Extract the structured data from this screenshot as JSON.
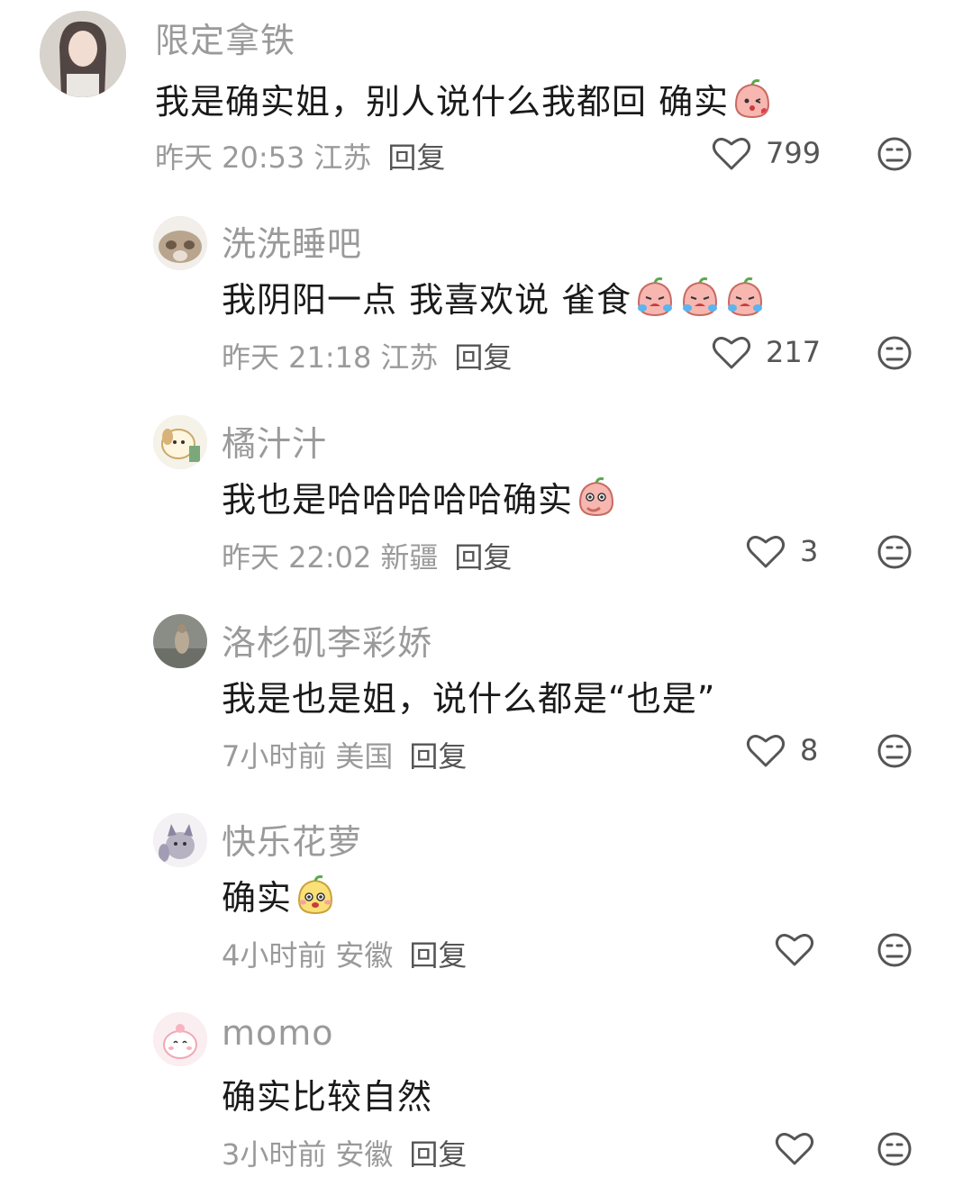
{
  "comments": [
    {
      "username": "限定拿铁",
      "text": "我是确实姐，别人说什么我都回 确实",
      "time": "昨天 20:53",
      "location": "江苏",
      "reply_label": "回复",
      "likes": "799",
      "emojis": [
        "peach-kiss-emoji"
      ]
    },
    {
      "username": "洗洗睡吧",
      "text": "我阴阳一点 我喜欢说 雀食",
      "time": "昨天 21:18",
      "location": "江苏",
      "reply_label": "回复",
      "likes": "217",
      "emojis": [
        "peach-crying-emoji",
        "peach-crying-emoji",
        "peach-crying-emoji"
      ]
    },
    {
      "username": "橘汁汁",
      "text": "我也是哈哈哈哈哈确实",
      "time": "昨天 22:02",
      "location": "新疆",
      "reply_label": "回复",
      "likes": "3",
      "emojis": [
        "peach-giggle-emoji"
      ]
    },
    {
      "username": "洛杉矶李彩娇",
      "text": "我是也是姐，说什么都是“也是”",
      "time": "7小时前",
      "location": "美国",
      "reply_label": "回复",
      "likes": "8",
      "emojis": []
    },
    {
      "username": "快乐花萝",
      "text": "确实",
      "time": "4小时前",
      "location": "安徽",
      "reply_label": "回复",
      "likes": "",
      "emojis": [
        "yellow-peach-emoji"
      ]
    },
    {
      "username": "momo",
      "text": "确实比较自然",
      "time": "3小时前",
      "location": "安徽",
      "reply_label": "回复",
      "likes": "",
      "emojis": []
    }
  ],
  "colors": {
    "meta_text": "#9a9a9a",
    "body_text": "#1a1a1a",
    "icon": "#555555"
  }
}
